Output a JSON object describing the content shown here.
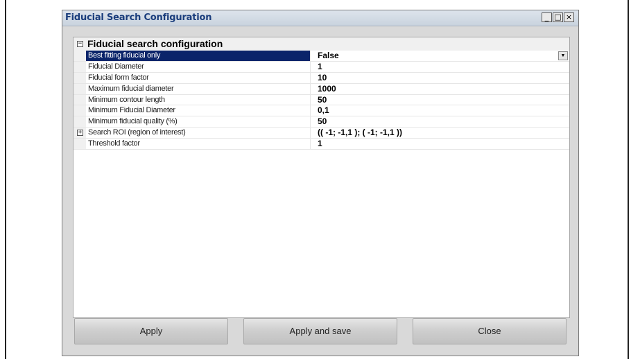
{
  "window": {
    "title": "Fiducial Search Configuration",
    "controls": {
      "minimize": "_",
      "maximize": "□",
      "close": "×"
    }
  },
  "grid": {
    "category": {
      "label": "Fiducial search configuration",
      "expander": "−"
    },
    "rows": [
      {
        "name": "Best fitting fiducial only",
        "value": "False",
        "selected": true,
        "dropdown_glyph": "▼"
      },
      {
        "name": "Fiducial Diameter",
        "value": "1"
      },
      {
        "name": "Fiducial form factor",
        "value": "10"
      },
      {
        "name": "Maximum fiducial diameter",
        "value": "1000"
      },
      {
        "name": "Minimum contour length",
        "value": "50"
      },
      {
        "name": "Minimum Fiducial Diameter",
        "value": "0,1"
      },
      {
        "name": "Minimum fiducial quality (%)",
        "value": "50"
      },
      {
        "name": "Search ROI (region of interest)",
        "value": "(( -1; -1,1 ); ( -1; -1,1 ))",
        "expander": "+"
      },
      {
        "name": "Threshold factor",
        "value": "1"
      }
    ]
  },
  "buttons": {
    "apply": "Apply",
    "apply_save": "Apply and save",
    "close": "Close"
  },
  "colors": {
    "selection": "#0a246a",
    "title_text": "#1a3d7c",
    "window_bg": "#d9d9d9"
  }
}
